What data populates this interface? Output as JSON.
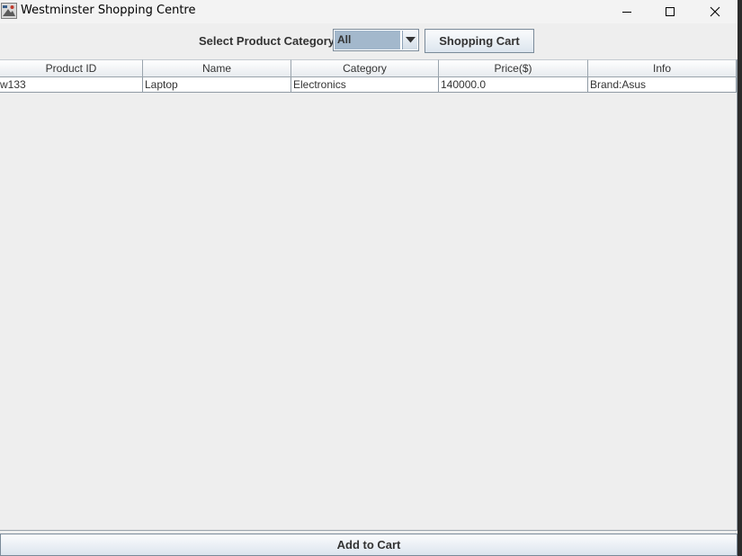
{
  "window": {
    "title": "Westminster Shopping Centre",
    "app_icon": "java-app-icon",
    "controls": {
      "minimize_icon": "minimize-icon",
      "maximize_icon": "maximize-icon",
      "close_icon": "close-icon"
    }
  },
  "toolbar": {
    "category_label": "Select Product Category",
    "category_selected": "All",
    "dropdown_icon": "chevron-down-icon",
    "cart_button_label": "Shopping Cart"
  },
  "table": {
    "columns": [
      "Product ID",
      "Name",
      "Category",
      "Price($)",
      "Info"
    ],
    "rows": [
      {
        "product_id": "w133",
        "name": "Laptop",
        "category": "Electronics",
        "price": "140000.0",
        "info": "Brand:Asus"
      }
    ]
  },
  "footer": {
    "add_to_cart_label": "Add to Cart"
  },
  "colors": {
    "window_bg": "#eeeeee",
    "selection_bg": "#a3b8cc",
    "border": "#7a8a99"
  }
}
